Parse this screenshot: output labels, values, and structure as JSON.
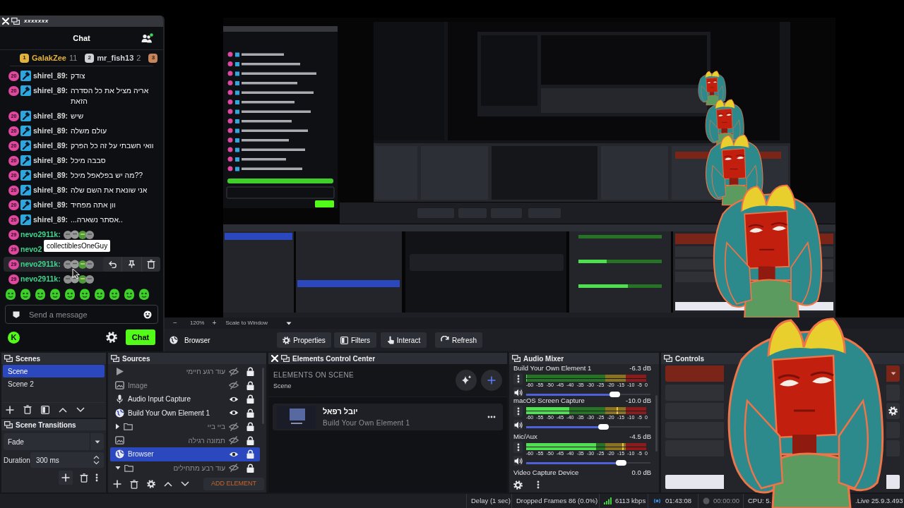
{
  "chat_window": {
    "title": "xxxxxxx"
  },
  "chat": {
    "title": "Chat",
    "leaderboard": [
      {
        "rank": "1",
        "name": "GalakZee",
        "count": "11",
        "color": "#e3b23c"
      },
      {
        "rank": "2",
        "name": "mr_fish13",
        "count": "2",
        "color": "#cfd2d6"
      },
      {
        "rank": "3",
        "color": "#c8845a"
      }
    ],
    "messages": [
      {
        "kind": "text",
        "badge": "20",
        "moderator": true,
        "user": "shirel_89:",
        "color": "#d9d9d9",
        "text": "צודק",
        "hovered": false
      },
      {
        "kind": "text",
        "badge": "20",
        "moderator": true,
        "user": "shirel_89:",
        "color": "#d9d9d9",
        "text": "אריה מציל את כל הסדרה הזאת",
        "hovered": false
      },
      {
        "kind": "text",
        "badge": "20",
        "moderator": true,
        "user": "shirel_89:",
        "color": "#d9d9d9",
        "text": "שיש",
        "hovered": false
      },
      {
        "kind": "text",
        "badge": "20",
        "moderator": true,
        "user": "shirel_89:",
        "color": "#d9d9d9",
        "text": "עולם משלה",
        "hovered": false
      },
      {
        "kind": "text",
        "badge": "20",
        "moderator": true,
        "user": "shirel_89:",
        "color": "#d9d9d9",
        "text": "וואי חשבתי על זה כל הפרק",
        "hovered": false
      },
      {
        "kind": "text",
        "badge": "20",
        "moderator": true,
        "user": "shirel_89:",
        "color": "#d9d9d9",
        "text": "סבבה מיכל",
        "hovered": false
      },
      {
        "kind": "text",
        "badge": "20",
        "moderator": true,
        "user": "shirel_89:",
        "color": "#d9d9d9",
        "text": "מה יש בפלאפל מיכל??",
        "hovered": false
      },
      {
        "kind": "text",
        "badge": "20",
        "moderator": true,
        "user": "shirel_89:",
        "color": "#d9d9d9",
        "text": "אני שונאת את השם שלה",
        "hovered": false
      },
      {
        "kind": "text",
        "badge": "20",
        "moderator": true,
        "user": "shirel_89:",
        "color": "#d9d9d9",
        "text": "וון אתה מפחיד",
        "hovered": false
      },
      {
        "kind": "text",
        "badge": "20",
        "moderator": true,
        "user": "shirel_89:",
        "color": "#d9d9d9",
        "text": "...אסתר נשארה..",
        "hovered": false
      },
      {
        "kind": "emote",
        "badge": "29",
        "moderator": false,
        "user": "nevo2911k:",
        "color": "#3ed68f",
        "hovered": false
      },
      {
        "kind": "text",
        "badge": "29",
        "moderator": false,
        "user": "nevo2",
        "color": "#3ed68f",
        "hovered": false
      },
      {
        "kind": "emote",
        "badge": "29",
        "moderator": false,
        "user": "nevo2911k:",
        "color": "#3ed68f",
        "hovered": true
      },
      {
        "kind": "emote",
        "badge": "29",
        "moderator": false,
        "user": "nevo2911k:",
        "color": "#3ed68f",
        "hovered": false
      }
    ],
    "tooltip": "collectiblesOneGuy",
    "input": {
      "placeholder": "Send a message"
    },
    "logo": "K",
    "send_button": "Chat"
  },
  "zoom_bar": {
    "minus": "−",
    "value": "120%",
    "plus": "+",
    "scale_mode": "Scale to Window"
  },
  "source_toolbar": {
    "source": "Browser",
    "buttons": [
      "Properties",
      "Filters",
      "Interact",
      "Refresh"
    ]
  },
  "scenes": {
    "title": "Scenes",
    "items": [
      {
        "name": "Scene",
        "selected": true
      },
      {
        "name": "Scene 2",
        "selected": false
      }
    ]
  },
  "transitions": {
    "title": "Scene Transitions",
    "type": "Fade",
    "duration_label": "Duration",
    "duration": "300 ms"
  },
  "sources": {
    "title": "Sources",
    "items": [
      {
        "kind": "media",
        "name": "עוד רגע חיימי",
        "visible": false,
        "locked": true,
        "selected": false
      },
      {
        "kind": "image",
        "name": "Image",
        "visible": false,
        "locked": true,
        "selected": false
      },
      {
        "kind": "audio",
        "name": "Audio Input Capture",
        "visible": true,
        "locked": true,
        "selected": false
      },
      {
        "kind": "browser",
        "name": "Build Your Own Element 1",
        "visible": true,
        "locked": true,
        "selected": false
      },
      {
        "kind": "group",
        "name": "ביי ביי",
        "visible": false,
        "locked": true,
        "selected": false,
        "expanded": false
      },
      {
        "kind": "image",
        "name": "תמונה רגילה",
        "visible": false,
        "locked": true,
        "selected": false
      },
      {
        "kind": "browser",
        "name": "Browser",
        "visible": true,
        "locked": true,
        "selected": true
      },
      {
        "kind": "group",
        "name": "עוד רבע מתחילים",
        "visible": false,
        "locked": true,
        "selected": false,
        "expanded": true
      }
    ],
    "add_button": "ADD ELEMENT"
  },
  "elements": {
    "title": "Elements Control Center",
    "heading": "ELEMENTS ON SCENE",
    "scene": "Scene",
    "items": [
      {
        "name": "יובל רפאל",
        "source": "Build Your Own Element 1"
      }
    ]
  },
  "audio_mixer": {
    "title": "Audio Mixer",
    "channels": [
      {
        "name": "Build Your Own Element 1",
        "reading": "-6.3 dB",
        "meter": {
          "level": 0
        },
        "scale": [
          "-60",
          "-55",
          "-50",
          "-45",
          "-40",
          "-35",
          "-30",
          "-25",
          "-20",
          "-15",
          "-10",
          "-5",
          "0"
        ],
        "volume": {
          "level": 0.71
        }
      },
      {
        "name": "macOS Screen Capture",
        "reading": "-10.0 dB",
        "meter": {
          "level": 0.36,
          "peak": {
            "level": 0.75
          }
        },
        "scale": [
          "-60",
          "-55",
          "-50",
          "-45",
          "-40",
          "-35",
          "-30",
          "-25",
          "-20",
          "-15",
          "-10",
          "-5",
          "0"
        ],
        "volume": {
          "level": 0.62
        }
      },
      {
        "name": "Mic/Aux",
        "reading": "-4.5 dB",
        "meter": {
          "level": 0.58,
          "peak": {
            "level": 0.8
          }
        },
        "scale": [
          "-60",
          "-55",
          "-50",
          "-45",
          "-40",
          "-35",
          "-30",
          "-25",
          "-20",
          "-15",
          "-10",
          "-5",
          "0"
        ],
        "volume": {
          "level": 0.76
        }
      },
      {
        "name": "Video Capture Device",
        "reading": "0.0 dB"
      }
    ]
  },
  "controls": {
    "title": "Controls",
    "buttons": [
      {
        "kind": "primary"
      },
      {
        "kind": "secondary"
      },
      {
        "kind": "split"
      },
      {
        "kind": "secondary"
      },
      {
        "kind": "secondary"
      },
      {
        "kind": "light"
      }
    ]
  },
  "status_bar": {
    "delay": "Delay (1 sec)",
    "dropped": "Dropped Frames 86 (0.0%)",
    "bitrate": "6113 kbps",
    "stream_time": "01:43:08",
    "record_time": "00:00:00",
    "cpu": "CPU: 5.",
    "version": ".Live 25.9.3.493"
  }
}
